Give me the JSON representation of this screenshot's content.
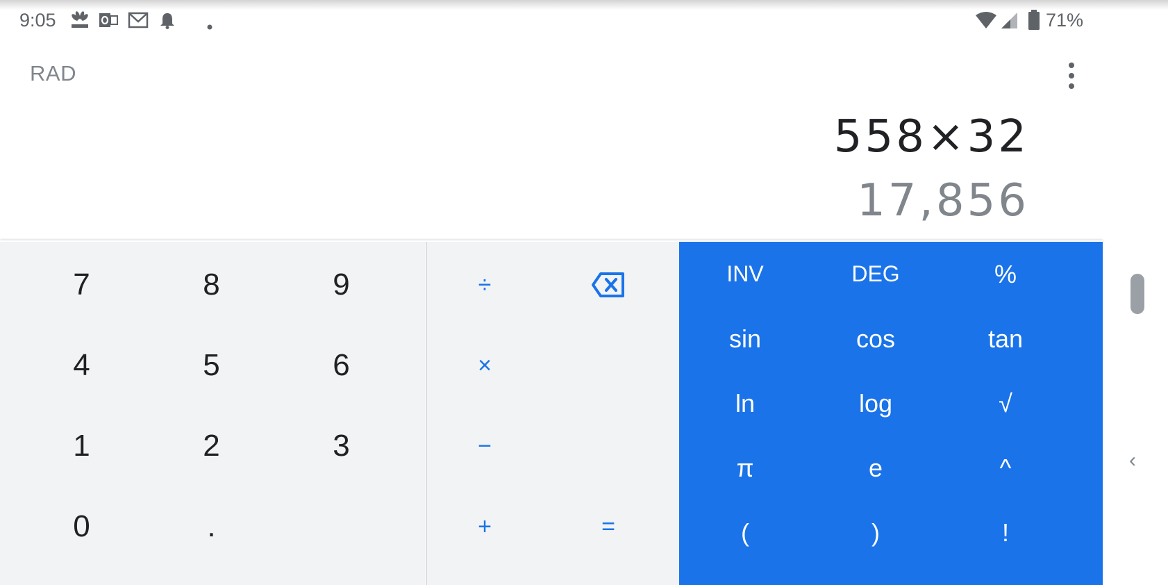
{
  "status_bar": {
    "time": "9:05",
    "left_icons": [
      "cnbc-icon",
      "outlook-icon",
      "gmail-icon",
      "notification-bell-icon",
      "dot-icon"
    ],
    "right_icons": [
      "wifi-icon",
      "cell-signal-icon",
      "battery-icon"
    ],
    "battery_percent": "71%"
  },
  "header": {
    "mode": "RAD",
    "menu_icon": "more-vert-icon"
  },
  "display": {
    "formula": "558×32",
    "result": "17,856"
  },
  "numpad": {
    "keys": [
      "7",
      "8",
      "9",
      "4",
      "5",
      "6",
      "1",
      "2",
      "3",
      "0",
      "."
    ]
  },
  "operators": {
    "divide": "÷",
    "delete_icon": "backspace-icon",
    "multiply": "×",
    "subtract": "−",
    "add": "+",
    "equals": "="
  },
  "advanced": {
    "keys": [
      "INV",
      "DEG",
      "%",
      "sin",
      "cos",
      "tan",
      "ln",
      "log",
      "√",
      "π",
      "e",
      "^",
      "(",
      ")",
      "!"
    ]
  },
  "colors": {
    "accent": "#1a73e8",
    "pad_background": "#f1f3f4",
    "text_primary": "#202124",
    "text_secondary": "#80868b"
  },
  "edge": {
    "chevron": "‹"
  }
}
